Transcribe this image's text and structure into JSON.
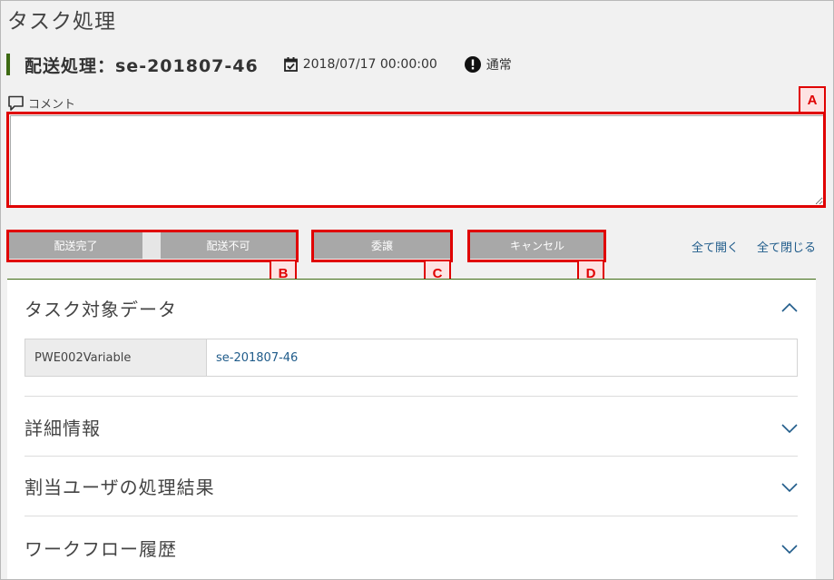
{
  "page": {
    "title": "タスク処理"
  },
  "task": {
    "title": "配送処理：se-201807-46",
    "date": "2018/07/17 00:00:00",
    "priority": "通常"
  },
  "comment": {
    "label": "コメント",
    "value": ""
  },
  "actions": {
    "complete": "配送完了",
    "fail": "配送不可",
    "delegate": "委譲",
    "cancel": "キャンセル",
    "open_all": "全て開く",
    "close_all": "全て閉じる"
  },
  "annotations": {
    "a": "A",
    "b": "B",
    "c": "C",
    "d": "D"
  },
  "sections": {
    "target_data": {
      "title": "タスク対象データ",
      "rows": [
        {
          "key": "PWE002Variable",
          "value": "se-201807-46"
        }
      ]
    },
    "details": {
      "title": "詳細情報"
    },
    "assignee_results": {
      "title": "割当ユーザの処理結果"
    },
    "workflow_history": {
      "title": "ワークフロー履歴"
    }
  },
  "colors": {
    "accent_green": "#3d6a13",
    "button_gray": "#a8a8a8",
    "link_blue": "#1f5b8a",
    "annotation_red": "#e00000"
  },
  "icons": {
    "date": "calendar-check-icon",
    "priority": "exclamation-circle-icon",
    "comment": "speech-bubble-icon",
    "expanded": "chevron-up-icon",
    "collapsed": "chevron-down-icon"
  }
}
